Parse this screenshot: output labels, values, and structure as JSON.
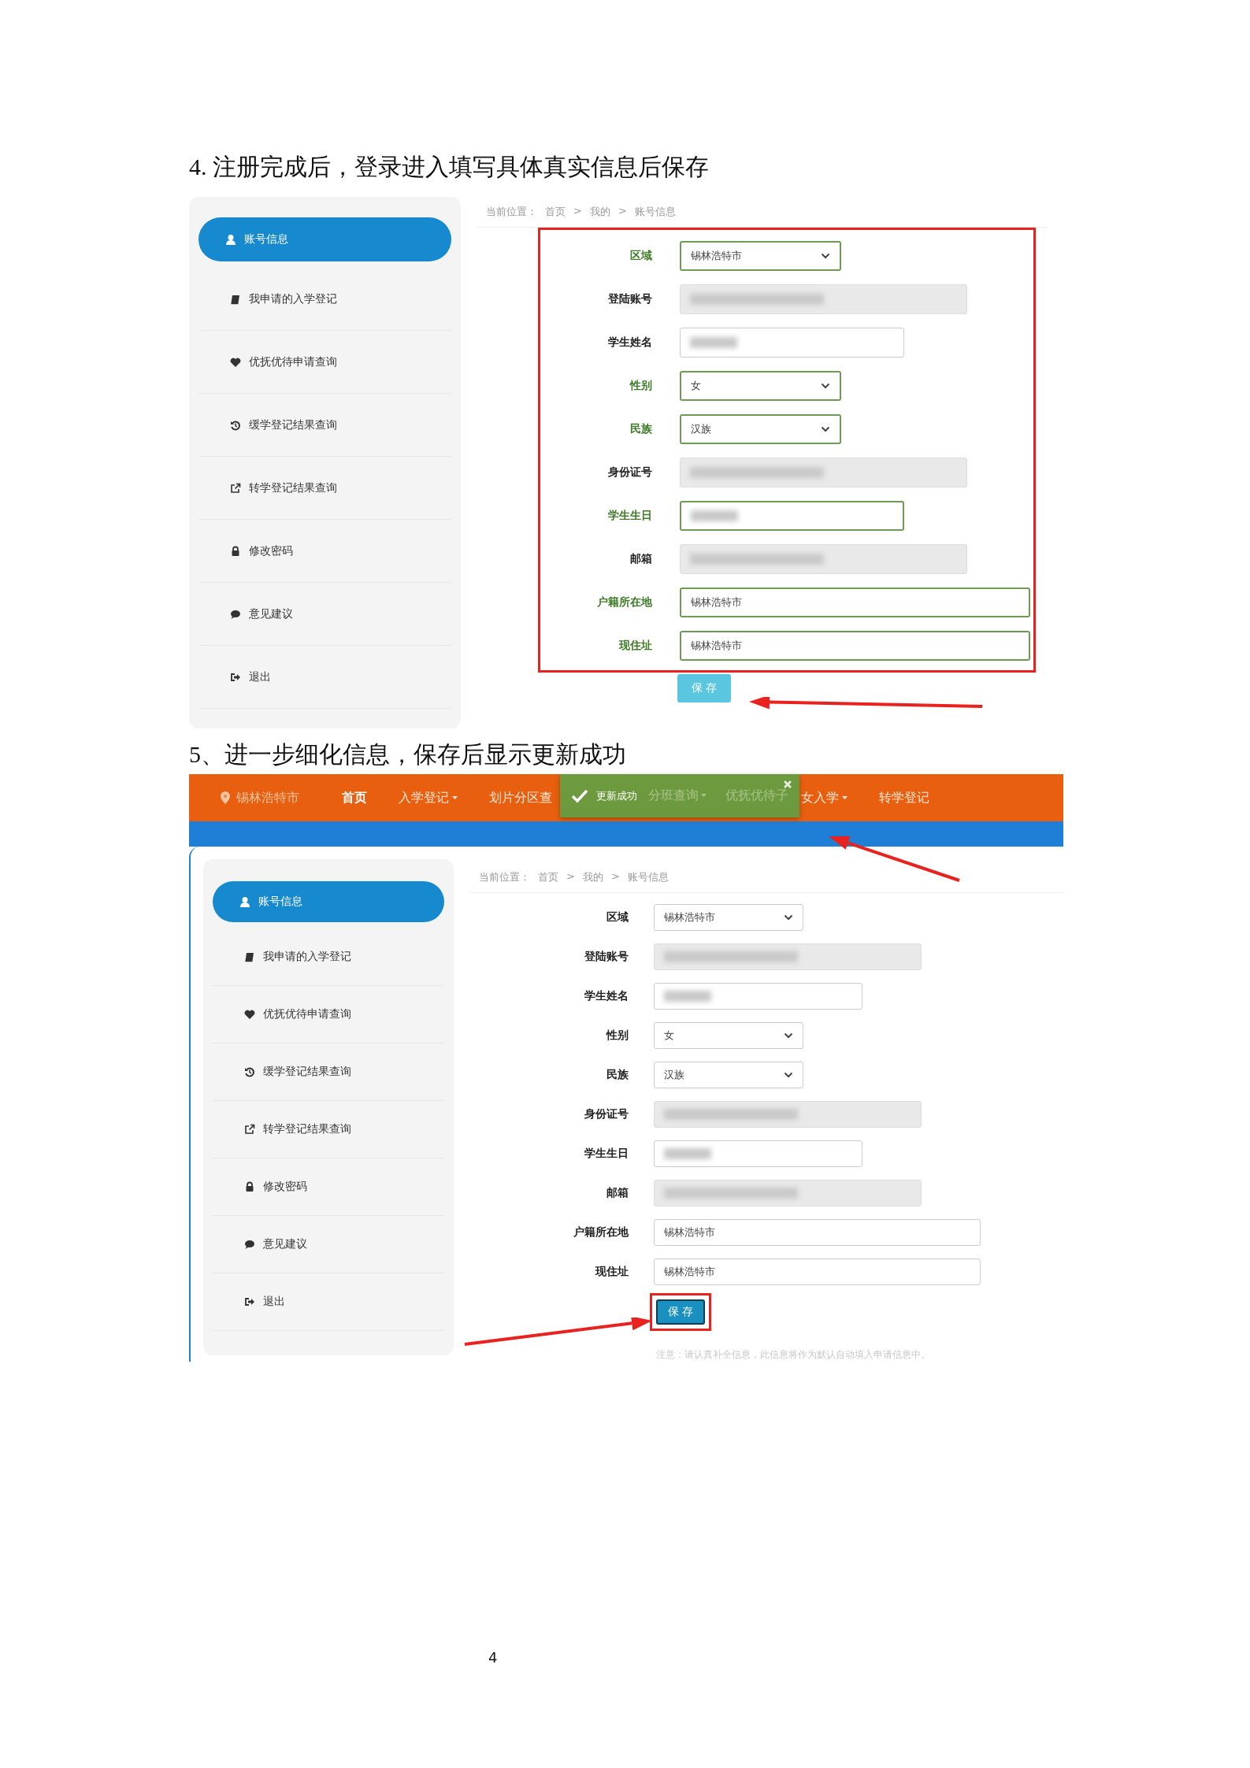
{
  "sections": [
    {
      "heading": "4. 注册完成后，登录进入填写具体真实信息后保存",
      "screen": {
        "sidebar": [
          {
            "label": "账号信息",
            "selected": true
          },
          {
            "label": "我申请的入学登记",
            "selected": false
          },
          {
            "label": "优抚优待申请查询",
            "selected": false
          },
          {
            "label": "缓学登记结果查询",
            "selected": false
          },
          {
            "label": "转学登记结果查询",
            "selected": false
          },
          {
            "label": "修改密码",
            "selected": false
          },
          {
            "label": "意见建议",
            "selected": false
          },
          {
            "label": "退出",
            "selected": false
          }
        ],
        "breadcrumb": [
          "当前位置：",
          "首页",
          ">",
          "我的",
          ">",
          "账号信息"
        ],
        "form_outlined": true,
        "fields": [
          {
            "label": "区域",
            "kind": "select",
            "value": "锡林浩特市",
            "valid": true,
            "masked": false
          },
          {
            "label": "登陆账号",
            "kind": "readonly",
            "valid": false,
            "masked": true
          },
          {
            "label": "学生姓名",
            "kind": "input",
            "valid": false,
            "masked": true
          },
          {
            "label": "性别",
            "kind": "select",
            "value": "女",
            "valid": true,
            "masked": false
          },
          {
            "label": "民族",
            "kind": "select",
            "value": "汉族",
            "valid": true,
            "masked": false
          },
          {
            "label": "身份证号",
            "kind": "readonly",
            "valid": false,
            "masked": true
          },
          {
            "label": "学生生日",
            "kind": "input",
            "valid": true,
            "masked": true
          },
          {
            "label": "邮箱",
            "kind": "readonly",
            "valid": false,
            "masked": true
          },
          {
            "label": "户籍所在地",
            "kind": "long_input",
            "value": "锡林浩特市",
            "valid": true,
            "masked": false
          },
          {
            "label": "现住址",
            "kind": "long_input",
            "value": "锡林浩特市",
            "valid": true,
            "masked": false
          }
        ],
        "save": {
          "label": "保 存",
          "highlighted": false
        }
      }
    },
    {
      "heading": "5、进一步细化信息，保存后显示更新成功",
      "screen": {
        "nav": [
          {
            "label": "锡林浩特市",
            "kind": "location",
            "dropdown": false
          },
          {
            "label": "首页",
            "kind": "current",
            "dropdown": false
          },
          {
            "label": "入学登记",
            "kind": "link",
            "dropdown": true
          },
          {
            "label": "划片分区查",
            "kind": "link",
            "dropdown": false
          },
          {
            "kind": "toast",
            "message": "更新成功",
            "behind": [
              {
                "label": "分班查询",
                "dropdown": true
              },
              {
                "label": "优抚优待子",
                "dropdown": false
              }
            ]
          },
          {
            "label": "女入学",
            "kind": "link",
            "dropdown": true
          },
          {
            "label": "转学登记",
            "kind": "link",
            "dropdown": false
          }
        ],
        "sidebar": [
          {
            "label": "账号信息",
            "selected": true
          },
          {
            "label": "我申请的入学登记",
            "selected": false
          },
          {
            "label": "优抚优待申请查询",
            "selected": false
          },
          {
            "label": "缓学登记结果查询",
            "selected": false
          },
          {
            "label": "转学登记结果查询",
            "selected": false
          },
          {
            "label": "修改密码",
            "selected": false
          },
          {
            "label": "意见建议",
            "selected": false
          },
          {
            "label": "退出",
            "selected": false
          }
        ],
        "breadcrumb": [
          "当前位置：",
          "首页",
          ">",
          "我的",
          ">",
          "账号信息"
        ],
        "form_outlined": false,
        "fields": [
          {
            "label": "区域",
            "kind": "select",
            "value": "锡林浩特市",
            "valid": false,
            "masked": false
          },
          {
            "label": "登陆账号",
            "kind": "readonly",
            "valid": false,
            "masked": true
          },
          {
            "label": "学生姓名",
            "kind": "input",
            "valid": false,
            "masked": true
          },
          {
            "label": "性别",
            "kind": "select",
            "value": "女",
            "valid": false,
            "masked": false
          },
          {
            "label": "民族",
            "kind": "select",
            "value": "汉族",
            "valid": false,
            "masked": false
          },
          {
            "label": "身份证号",
            "kind": "readonly",
            "valid": false,
            "masked": true
          },
          {
            "label": "学生生日",
            "kind": "input",
            "valid": false,
            "masked": true
          },
          {
            "label": "邮箱",
            "kind": "readonly",
            "valid": false,
            "masked": true
          },
          {
            "label": "户籍所在地",
            "kind": "long_input",
            "value": "锡林浩特市",
            "valid": false,
            "masked": false
          },
          {
            "label": "现住址",
            "kind": "long_input",
            "value": "锡林浩特市",
            "valid": false,
            "masked": false
          }
        ],
        "save": {
          "label": "保 存",
          "highlighted": true
        },
        "note": "注意：请认真补全信息，此信息将作为默认自动填入申请信息中。"
      }
    }
  ],
  "page_number": "4"
}
